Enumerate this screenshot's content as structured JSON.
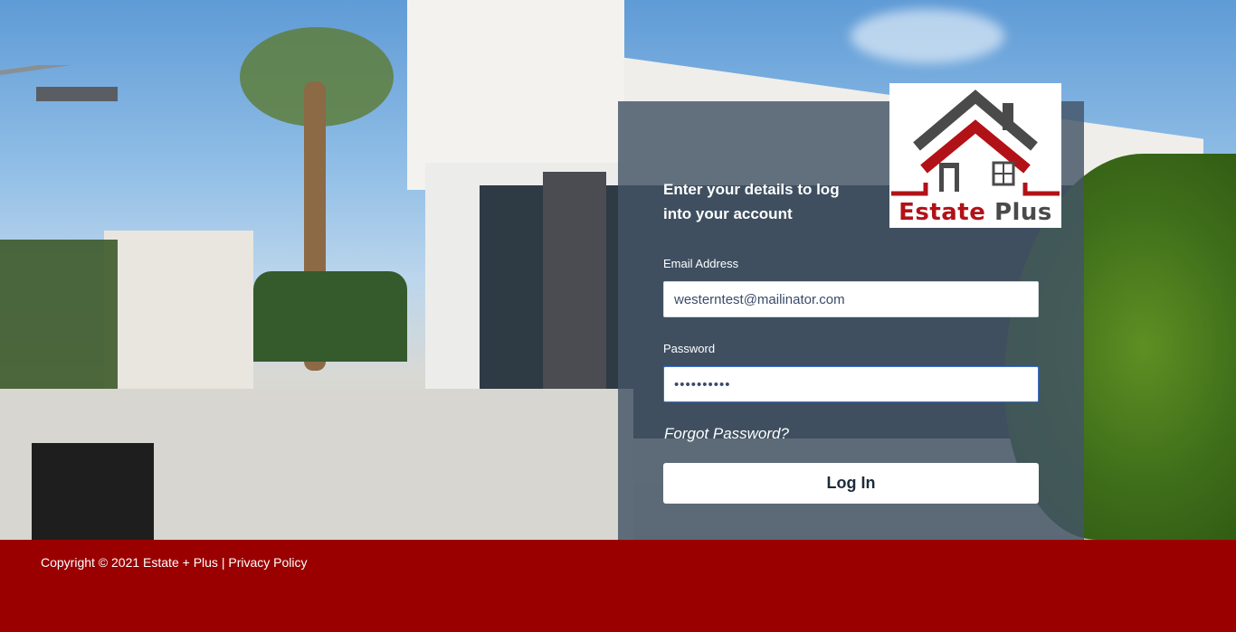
{
  "brand": {
    "logo_word1": "Estate",
    "logo_word2": "Plus",
    "red": "#b11218",
    "gray": "#4a4a4a"
  },
  "login": {
    "intro_line1": "Enter your details to log",
    "intro_line2": "into your account",
    "email_label": "Email Address",
    "email_value": "westerntest@mailinator.com",
    "password_label": "Password",
    "password_value": "••••••••••",
    "forgot_label": "Forgot Password?",
    "login_label": "Log In"
  },
  "footer": {
    "copyright": "Copyright © 2021 Estate + Plus",
    "separator": "|",
    "privacy_label": "Privacy Policy",
    "bg_color": "#9b0000"
  }
}
